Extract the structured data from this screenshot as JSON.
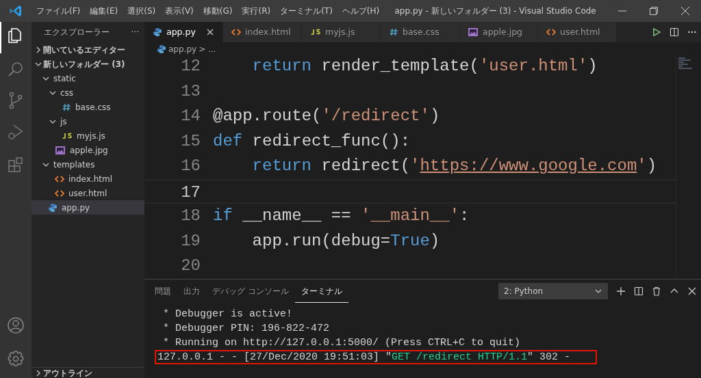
{
  "window": {
    "title": "app.py - 新しいフォルダー (3) - Visual Studio Code"
  },
  "menu": [
    "ファイル(F)",
    "編集(E)",
    "選択(S)",
    "表示(V)",
    "移動(G)",
    "実行(R)",
    "ターミナル(T)",
    "ヘルプ(H)"
  ],
  "activity_bar": [
    {
      "kind": "explorer",
      "selected": true
    },
    {
      "kind": "search",
      "selected": false
    },
    {
      "kind": "source-control",
      "selected": false
    },
    {
      "kind": "debug",
      "selected": false
    },
    {
      "kind": "extensions",
      "selected": false
    }
  ],
  "activity_bar_bottom": [
    {
      "kind": "account"
    },
    {
      "kind": "settings"
    }
  ],
  "sidebar": {
    "title": "エクスプローラー",
    "more": "···",
    "sections": [
      {
        "label": "開いているエディター",
        "expanded": false
      },
      {
        "label": "新しいフォルダー (3)",
        "expanded": true
      }
    ],
    "tree": [
      {
        "label": "static",
        "kind": "folder",
        "expanded": true,
        "selected": false,
        "children": [
          {
            "label": "css",
            "kind": "folder",
            "expanded": true,
            "selected": false,
            "children": [
              {
                "label": "base.css",
                "kind": "css",
                "selected": false
              }
            ]
          },
          {
            "label": "js",
            "kind": "folder",
            "expanded": true,
            "selected": false,
            "children": [
              {
                "label": "myjs.js",
                "kind": "js",
                "selected": false
              }
            ]
          },
          {
            "label": "apple.jpg",
            "kind": "image",
            "selected": false
          }
        ]
      },
      {
        "label": "templates",
        "kind": "folder",
        "expanded": true,
        "selected": false,
        "children": [
          {
            "label": "index.html",
            "kind": "html",
            "selected": false
          },
          {
            "label": "user.html",
            "kind": "html",
            "selected": false
          }
        ]
      },
      {
        "label": "app.py",
        "kind": "python",
        "selected": true
      }
    ],
    "outline": "アウトライン"
  },
  "tabs": [
    {
      "label": "app.py",
      "kind": "python",
      "selected": true
    },
    {
      "label": "index.html",
      "kind": "html",
      "selected": false
    },
    {
      "label": "myjs.js",
      "kind": "js",
      "selected": false
    },
    {
      "label": "base.css",
      "kind": "css",
      "selected": false
    },
    {
      "label": "apple.jpg",
      "kind": "image",
      "selected": false
    },
    {
      "label": "user.html",
      "kind": "html",
      "selected": false
    }
  ],
  "breadcrumb": {
    "file": "app.py",
    "rest": "> ..."
  },
  "code": [
    {
      "number": "12",
      "current": false,
      "tokens": [
        {
          "text": "    return",
          "kind": "keyword"
        },
        {
          "text": " render_template(",
          "kind": "plain"
        },
        {
          "text": "'user.html'",
          "kind": "string"
        },
        {
          "text": ")",
          "kind": "plain"
        }
      ]
    },
    {
      "number": "13",
      "current": false
    },
    {
      "number": "14",
      "current": false,
      "tokens": [
        {
          "text": "@app.route(",
          "kind": "plain"
        },
        {
          "text": "'/redirect'",
          "kind": "string"
        },
        {
          "text": ")",
          "kind": "plain"
        }
      ]
    },
    {
      "number": "15",
      "current": false,
      "tokens": [
        {
          "text": "def",
          "kind": "keyword"
        },
        {
          "text": " redirect_func():",
          "kind": "plain"
        }
      ]
    },
    {
      "number": "16",
      "current": false,
      "tokens": [
        {
          "text": "    return",
          "kind": "keyword"
        },
        {
          "text": " redirect(",
          "kind": "plain"
        },
        {
          "text": "'",
          "kind": "string"
        },
        {
          "text": "https://www.google.com",
          "kind": "link"
        },
        {
          "text": "'",
          "kind": "string"
        },
        {
          "text": ")",
          "kind": "plain"
        }
      ]
    },
    {
      "number": "17",
      "current": true
    },
    {
      "number": "18",
      "current": false,
      "tokens": [
        {
          "text": "if",
          "kind": "keyword"
        },
        {
          "text": " __name__ == ",
          "kind": "plain"
        },
        {
          "text": "'__main__'",
          "kind": "string"
        },
        {
          "text": ":",
          "kind": "plain"
        }
      ]
    },
    {
      "number": "19",
      "current": false,
      "tokens": [
        {
          "text": "    app.run(debug=",
          "kind": "plain"
        },
        {
          "text": "True",
          "kind": "keyword"
        },
        {
          "text": ")",
          "kind": "plain"
        }
      ]
    },
    {
      "number": "20",
      "current": false
    }
  ],
  "panel": {
    "tabs": [
      {
        "label": "問題",
        "selected": false
      },
      {
        "label": "出力",
        "selected": false
      },
      {
        "label": "デバッグ コンソール",
        "selected": false
      },
      {
        "label": "ターミナル",
        "selected": true
      }
    ],
    "terminal_select": "2: Python",
    "terminal": [
      {
        "highlighted": false,
        "tokens": [
          {
            "text": " * Debugger is active!",
            "kind": "plain"
          }
        ]
      },
      {
        "highlighted": false,
        "tokens": [
          {
            "text": " * Debugger PIN: 196-822-472",
            "kind": "plain"
          }
        ]
      },
      {
        "highlighted": false,
        "tokens": [
          {
            "text": " * Running on http://127.0.0.1:5000/ (Press CTRL+C to quit)",
            "kind": "plain"
          }
        ]
      },
      {
        "highlighted": true,
        "tokens": [
          {
            "text": "127.0.0.1 - - [27/Dec/2020 19:51:03] \"",
            "kind": "plain"
          },
          {
            "text": "GET /redirect HTTP/1.1",
            "kind": "green"
          },
          {
            "text": "\" 302 -",
            "kind": "plain"
          }
        ]
      }
    ]
  }
}
